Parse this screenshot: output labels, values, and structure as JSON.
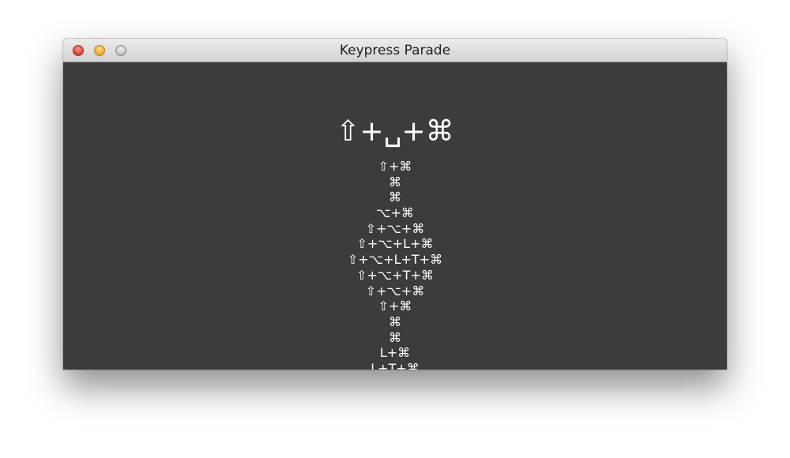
{
  "window": {
    "title": "Keypress Parade",
    "controls": [
      "close",
      "minimize",
      "zoom"
    ]
  },
  "current_combo": "⇧+␣+⌘",
  "history": [
    "⇧+⌘",
    "⌘",
    "⌘",
    "⌥+⌘",
    "⇧+⌥+⌘",
    "⇧+⌥+L+⌘",
    "⇧+⌥+L+T+⌘",
    "⇧+⌥+T+⌘",
    "⇧+⌥+⌘",
    "⇧+⌘",
    "⌘",
    "⌘",
    "L+⌘",
    "L+T+⌘"
  ],
  "colors": {
    "content_background": "#3c3c3c",
    "text": "#ffffff"
  }
}
